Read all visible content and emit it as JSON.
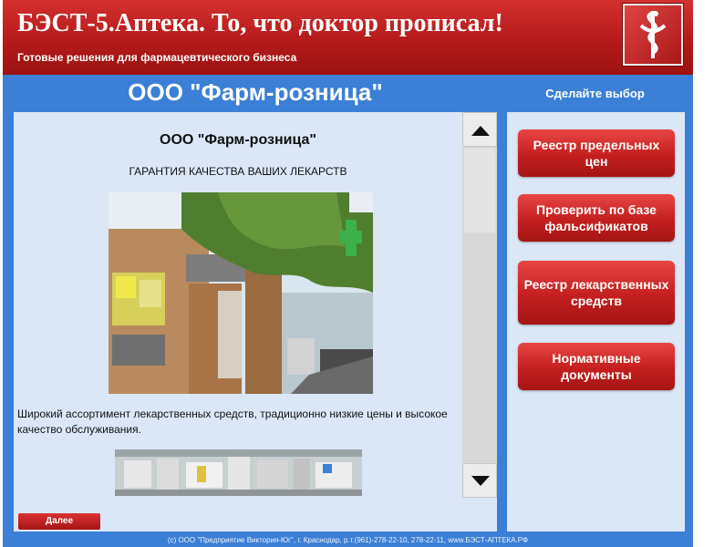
{
  "header": {
    "title": "БЭСТ-5.Аптека. То, что доктор прописал!",
    "subtitle": "Готовые решения для фармацевтического бизнеса",
    "logo_icon": "caduceus-bowl-snake-icon"
  },
  "company": {
    "title": "ООО \"Фарм-розница\""
  },
  "sidebar": {
    "prompt": "Сделайте выбор",
    "buttons": [
      {
        "label": "Реестр предельных цен"
      },
      {
        "label": "Проверить по базе фальсификатов"
      },
      {
        "label": "Реестр лекарственных средств"
      },
      {
        "label": "Нормативные документы"
      }
    ]
  },
  "content": {
    "heading": "ООО \"Фарм-розница\"",
    "subheading": "ГАРАНТИЯ КАЧЕСТВА ВАШИХ ЛЕКАРСТВ",
    "description": "Широкий ассортимент лекарственных средств, традиционно низкие цены и высокое качество обслуживания."
  },
  "nav": {
    "next_label": "Далее"
  },
  "footer": {
    "text": "(c) ООО \"Предприятие Виктория-Юг\", г. Краснодар, р.т.(961)-278-22-10, 278-22-11, www.БЭСТ-АПТЕКА.РФ"
  },
  "colors": {
    "brand_red": "#c41f1f",
    "frame_blue": "#3b7fd6",
    "panel_bg": "#dbe7f7"
  }
}
